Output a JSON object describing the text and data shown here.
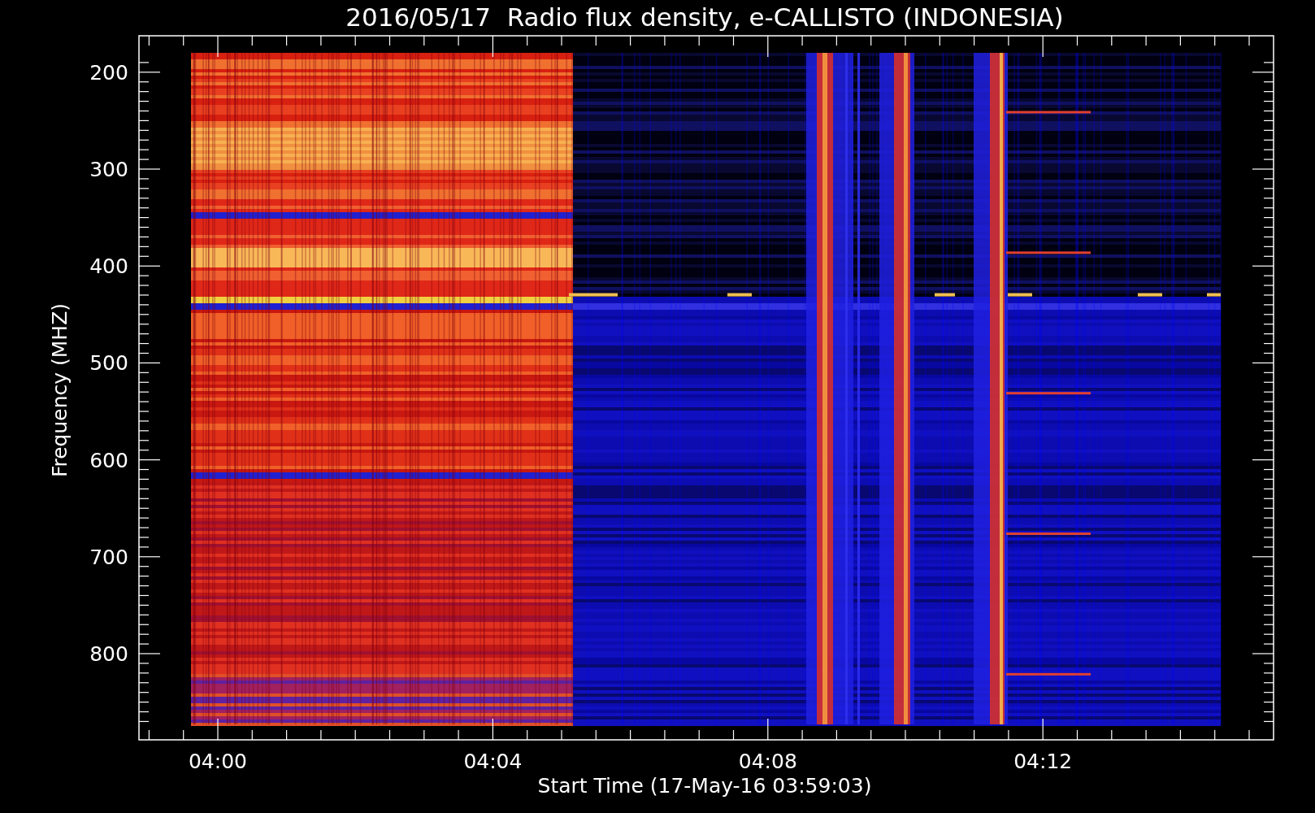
{
  "title": "2016/05/17  Radio flux density, e-CALLISTO (INDONESIA)",
  "y_axis": {
    "label": "Frequency (MHZ)",
    "ticks": [
      "200",
      "300",
      "400",
      "500",
      "600",
      "700",
      "800"
    ]
  },
  "x_axis": {
    "label": "Start Time (17-May-16 03:59:03)",
    "ticks": [
      "04:00",
      "04:04",
      "04:08",
      "04:12"
    ]
  }
}
